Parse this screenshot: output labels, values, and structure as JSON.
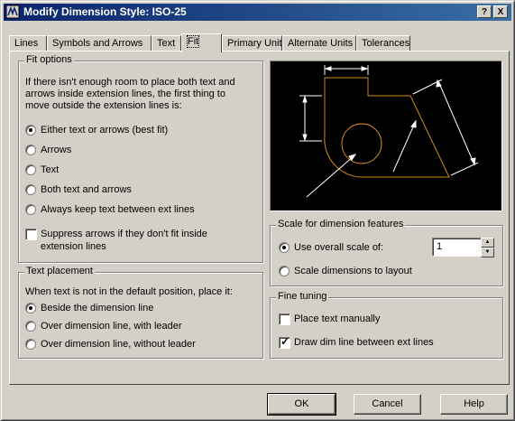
{
  "window": {
    "title": "Modify Dimension Style: ISO-25",
    "help_btn": "?",
    "close_btn": "X"
  },
  "tabs": [
    "Lines",
    "Symbols and Arrows",
    "Text",
    "Fit",
    "Primary Units",
    "Alternate Units",
    "Tolerances"
  ],
  "active_tab": "Fit",
  "fit_options": {
    "legend": "Fit options",
    "description": [
      "If there isn't enough room to place both text and",
      "arrows inside extension lines, the first thing to",
      "move outside the extension lines is:"
    ],
    "radios": [
      {
        "label": "Either text or arrows (best fit)",
        "selected": true
      },
      {
        "label": "Arrows",
        "selected": false
      },
      {
        "label": "Text",
        "selected": false
      },
      {
        "label": "Both text and arrows",
        "selected": false
      },
      {
        "label": "Always keep text between ext lines",
        "selected": false
      }
    ],
    "suppress_label": [
      "Suppress arrows if they don't fit inside",
      "extension lines"
    ],
    "suppress_checked": false
  },
  "text_placement": {
    "legend": "Text placement",
    "description": "When text is not in the default position, place it:",
    "radios": [
      {
        "label": "Beside the dimension line",
        "selected": true
      },
      {
        "label": "Over dimension line, with leader",
        "selected": false
      },
      {
        "label": "Over dimension line, without leader",
        "selected": false
      }
    ]
  },
  "scale": {
    "legend": "Scale for dimension features",
    "use_overall_label": "Use overall scale of:",
    "use_overall_selected": true,
    "overall_value": "1",
    "layout_label": "Scale dimensions to layout",
    "layout_selected": false
  },
  "fine_tuning": {
    "legend": "Fine tuning",
    "place_manually_label": "Place text manually",
    "place_manually_checked": false,
    "draw_dim_label": "Draw dim line between ext lines",
    "draw_dim_checked": true
  },
  "buttons": {
    "ok": "OK",
    "cancel": "Cancel",
    "help": "Help"
  },
  "colors": {
    "title_start": "#0a246a",
    "title_end": "#3a6ea5",
    "preview_bg": "#000000",
    "preview_geometry": "#d88a1c",
    "preview_dims": "#ffffff"
  }
}
